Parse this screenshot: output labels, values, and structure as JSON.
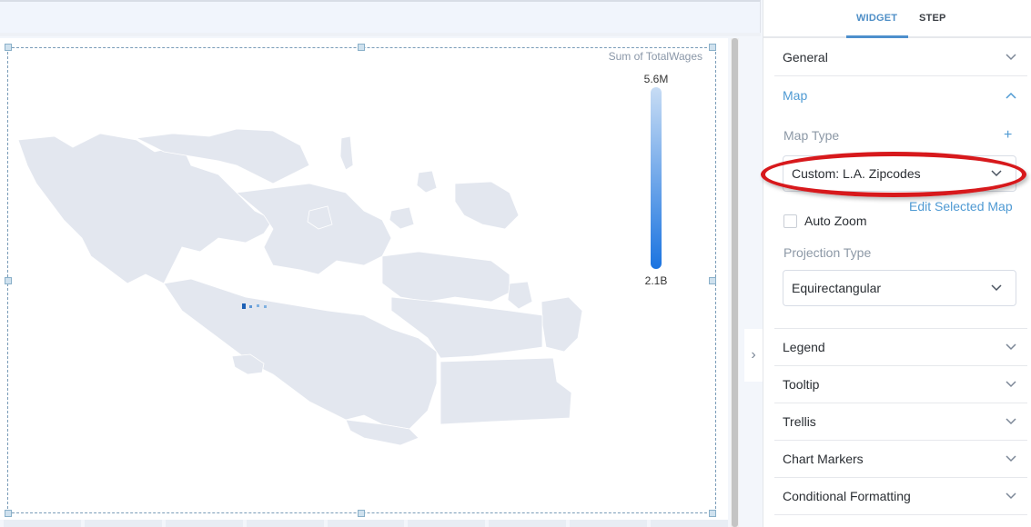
{
  "panel": {
    "tabs": [
      {
        "label": "WIDGET",
        "active": true
      },
      {
        "label": "STEP",
        "active": false
      }
    ],
    "sections": [
      {
        "label": "General",
        "expanded": false
      },
      {
        "label": "Map",
        "expanded": true
      },
      {
        "label": "Legend",
        "expanded": false
      },
      {
        "label": "Tooltip",
        "expanded": false
      },
      {
        "label": "Trellis",
        "expanded": false
      },
      {
        "label": "Chart Markers",
        "expanded": false
      },
      {
        "label": "Conditional Formatting",
        "expanded": false
      }
    ],
    "map": {
      "map_type_label": "Map Type",
      "add_icon": "plus-icon",
      "map_type_value": "Custom: L.A. Zipcodes",
      "edit_link": "Edit Selected Map",
      "auto_zoom_label": "Auto Zoom",
      "auto_zoom_checked": false,
      "projection_label": "Projection Type",
      "projection_value": "Equirectangular"
    },
    "collapse_icon": "chevron-right-icon"
  },
  "widget": {
    "legend": {
      "title": "Sum of TotalWages",
      "max_label": "5.6M",
      "min_label": "2.1B",
      "color_low": "#c7dcf4",
      "color_high": "#1b74e0"
    },
    "map_fill_color": "#e3e7ef",
    "map_highlight_color": "#1b5fb5",
    "region": "L.A. Zipcodes"
  },
  "colors": {
    "accent": "#4f9ad3",
    "annotation_ring": "#d7191c"
  }
}
